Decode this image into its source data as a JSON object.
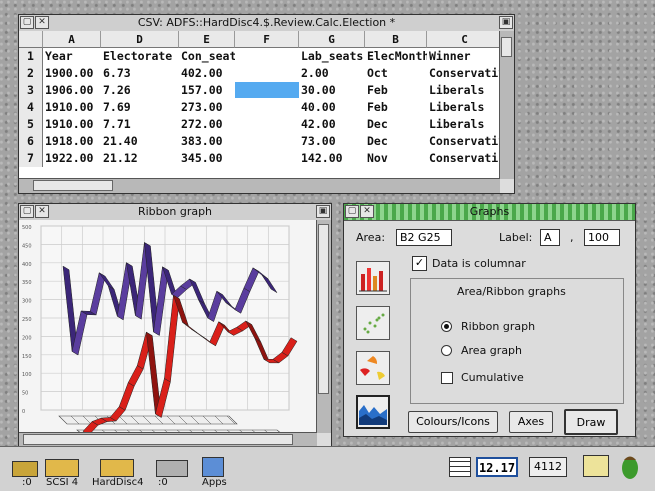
{
  "spreadsheet": {
    "title": "CSV: ADFS::HardDisc4.$.Review.Calc.Election *",
    "columns": [
      "A",
      "D",
      "E",
      "F",
      "G",
      "B",
      "C"
    ],
    "rows": [
      {
        "n": "1",
        "cells": [
          "Year",
          "Electorate",
          "Con_seats",
          "",
          "Lab_seats",
          "ElecMonth",
          "Winner"
        ]
      },
      {
        "n": "2",
        "cells": [
          "1900.00",
          "6.73",
          "402.00",
          "",
          "2.00",
          "Oct",
          "Conservativ"
        ]
      },
      {
        "n": "3",
        "cells": [
          "1906.00",
          "7.26",
          "157.00",
          "",
          "30.00",
          "Feb",
          "Liberals"
        ]
      },
      {
        "n": "4",
        "cells": [
          "1910.00",
          "7.69",
          "273.00",
          "",
          "40.00",
          "Feb",
          "Liberals"
        ]
      },
      {
        "n": "5",
        "cells": [
          "1910.00",
          "7.71",
          "272.00",
          "",
          "42.00",
          "Dec",
          "Liberals"
        ]
      },
      {
        "n": "6",
        "cells": [
          "1918.00",
          "21.40",
          "383.00",
          "",
          "73.00",
          "Dec",
          "Conservativ"
        ]
      },
      {
        "n": "7",
        "cells": [
          "1922.00",
          "21.12",
          "345.00",
          "",
          "142.00",
          "Nov",
          "Conservati"
        ]
      }
    ]
  },
  "ribbon_window": {
    "title": "Ribbon graph",
    "y_ticks": [
      "500",
      "450",
      "400",
      "350",
      "300",
      "250",
      "200",
      "150",
      "100",
      "50",
      "0"
    ]
  },
  "graphs_dialog": {
    "title": "Graphs",
    "area_label": "Area:",
    "area_value": "B2 G25",
    "label_label": "Label:",
    "label_value": "A",
    "label_sep": ",",
    "label_count": "100",
    "columnar_label": "Data is columnar",
    "group_title": "Area/Ribbon graphs",
    "ribbon_option": "Ribbon graph",
    "area_option": "Area graph",
    "cumulative_label": "Cumulative",
    "colours_button": "Colours/Icons",
    "axes_button": "Axes",
    "draw_button": "Draw"
  },
  "iconbar": {
    "items": [
      ":0",
      "SCSI 4",
      "HardDisc4",
      ":0",
      "Apps"
    ],
    "clock_value": "12.17",
    "memory_value": "4112"
  },
  "chart_data": {
    "type": "area",
    "title": "",
    "series": [
      {
        "name": "Con_seats",
        "values": [
          402,
          157,
          273,
          272,
          383,
          345,
          258,
          412,
          260,
          470,
          213,
          400,
          321,
          345,
          365,
          304,
          253,
          330,
          297,
          277,
          339,
          397,
          376,
          336
        ]
      },
      {
        "name": "Lab_seats",
        "values": [
          2,
          30,
          40,
          42,
          73,
          142,
          191,
          287,
          52,
          154,
          393,
          315,
          295,
          277,
          258,
          317,
          288,
          301,
          319,
          269,
          209,
          209,
          229,
          271
        ]
      }
    ],
    "colors": {
      "Con_seats": "#5a3d9e",
      "Lab_seats": "#d9201a"
    },
    "ylim": [
      0,
      500
    ],
    "grid": true
  }
}
